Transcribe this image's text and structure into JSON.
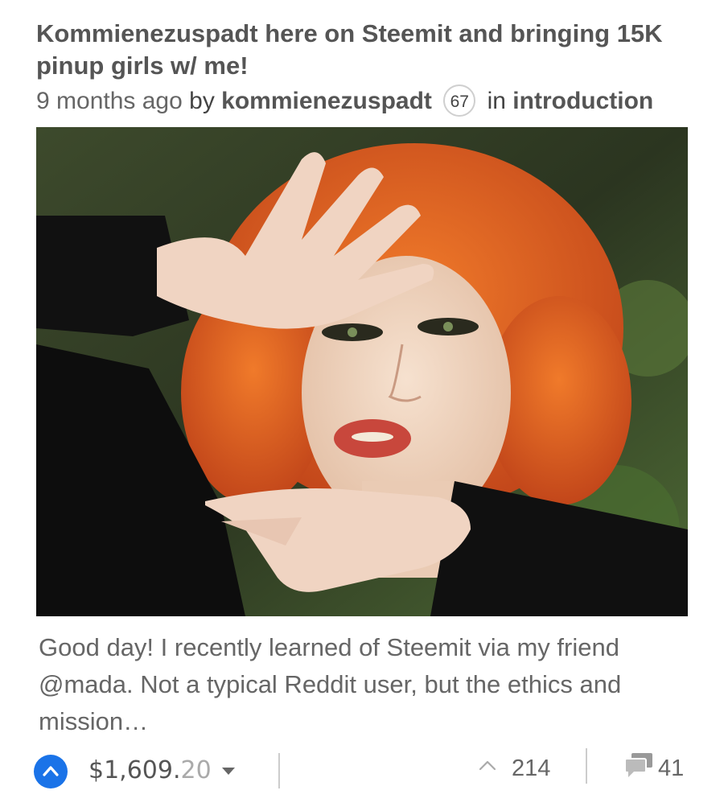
{
  "post": {
    "title": "Kommienezuspadt here on Steemit and bringing 15K pinup girls w/ me!",
    "time": "9 months ago",
    "by_label": "by",
    "author": "kommienezuspadt",
    "reputation": "67",
    "in_label": "in",
    "category": "introduction",
    "excerpt": "Good day!  I recently learned of Steemit via my friend @mada. Not a typical Reddit user, but the ethics and mission…"
  },
  "footer": {
    "payout_main": "$1,609.",
    "payout_cents": "20",
    "votes": "214",
    "comments": "41"
  },
  "icons": {
    "upvote": "upvote-chevron-icon",
    "payout_dropdown": "caret-down-icon",
    "votes": "up-caret-icon",
    "comments": "speech-bubbles-icon"
  },
  "colors": {
    "accent": "#1a73e8",
    "text": "#555555",
    "muted": "#aaaaaa"
  }
}
